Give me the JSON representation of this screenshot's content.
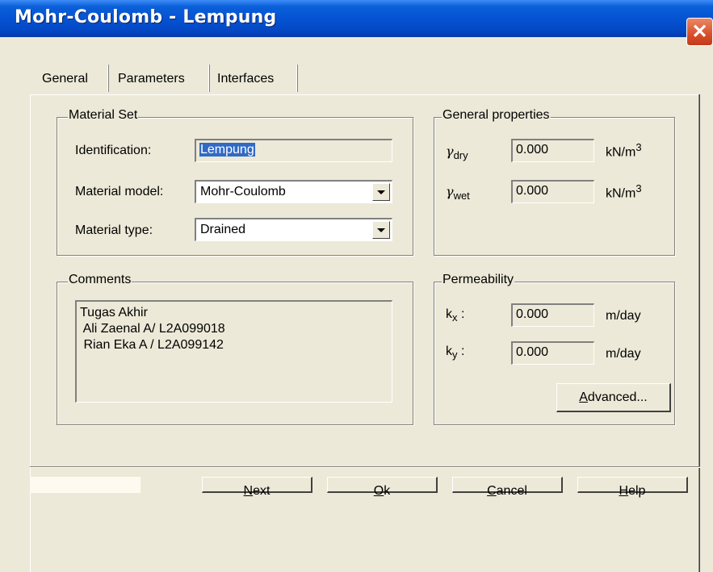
{
  "window": {
    "title": "Mohr-Coulomb - Lempung",
    "close_glyph": "✕"
  },
  "tabs": [
    "General",
    "Parameters",
    "Interfaces"
  ],
  "material_set": {
    "legend": "Material Set",
    "identification_label": "Identification:",
    "identification_value": "Lempung",
    "model_label": "Material model:",
    "model_value": "Mohr-Coulomb",
    "type_label": "Material type:",
    "type_value": "Drained"
  },
  "general_properties": {
    "legend": "General properties",
    "gamma_dry": {
      "symbol": "γ",
      "sub": "dry",
      "value": "0.000",
      "unit": "kN/m",
      "unit_sup": "3"
    },
    "gamma_wet": {
      "symbol": "γ",
      "sub": "wet",
      "value": "0.000",
      "unit": "kN/m",
      "unit_sup": "3"
    }
  },
  "comments": {
    "legend": "Comments",
    "lines": [
      "Tugas Akhir",
      " Ali Zaenal A/ L2A099018",
      " Rian Eka A / L2A099142"
    ]
  },
  "permeability": {
    "legend": "Permeability",
    "kx": {
      "symbol": "k",
      "sub": "x",
      "colon": ":",
      "value": "0.000",
      "unit": "m/day"
    },
    "ky": {
      "symbol": "k",
      "sub": "y",
      "colon": ":",
      "value": "0.000",
      "unit": "m/day"
    },
    "advanced_button": {
      "accel": "A",
      "rest": "dvanced..."
    }
  },
  "buttons": {
    "next": {
      "accel": "N",
      "rest": "ext"
    },
    "ok": {
      "accel": "O",
      "rest": "k"
    },
    "cancel": {
      "accel": "C",
      "rest": "ancel"
    },
    "help": {
      "accel": "H",
      "rest": "elp"
    }
  }
}
